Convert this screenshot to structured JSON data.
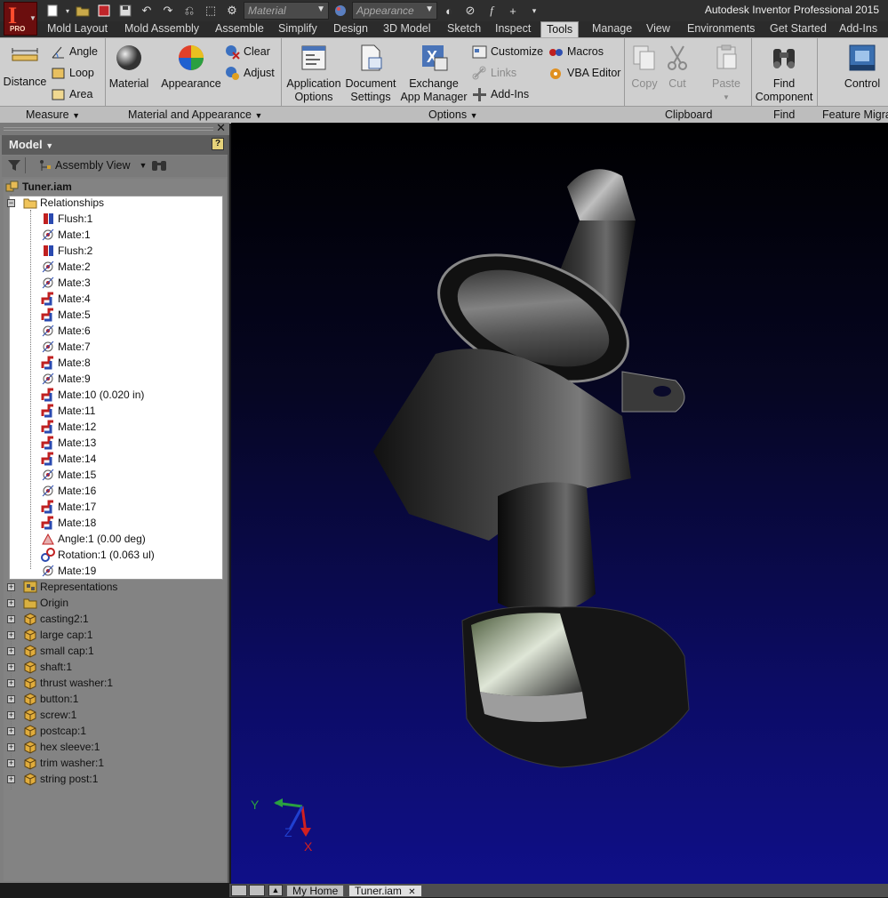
{
  "titlebar": {
    "app_title": "Autodesk Inventor Professional 2015",
    "logo_letter": "I",
    "logo_sub": "PRO",
    "material_select": "Material",
    "appearance_select": "Appearance"
  },
  "ribbon_tabs": [
    {
      "label": "Mold Layout"
    },
    {
      "label": "Mold Assembly"
    },
    {
      "label": "Assemble"
    },
    {
      "label": "Simplify"
    },
    {
      "label": "Design"
    },
    {
      "label": "3D Model"
    },
    {
      "label": "Sketch"
    },
    {
      "label": "Inspect"
    },
    {
      "label": "Tools"
    },
    {
      "label": "Manage"
    },
    {
      "label": "View"
    },
    {
      "label": "Environments"
    },
    {
      "label": "Get Started"
    },
    {
      "label": "Add-Ins"
    }
  ],
  "active_tab": "Tools",
  "ribbon": {
    "distance": "Distance",
    "angle": "Angle",
    "loop": "Loop",
    "area": "Area",
    "material": "Material",
    "appearance": "Appearance",
    "clear": "Clear",
    "adjust": "Adjust",
    "app_options_1": "Application",
    "app_options_2": "Options",
    "doc_settings_1": "Document",
    "doc_settings_2": "Settings",
    "exchange_1": "Exchange",
    "exchange_2": "App Manager",
    "customize": "Customize",
    "links": "Links",
    "addins": "Add-Ins",
    "macros": "Macros",
    "vba_editor": "VBA Editor",
    "copy": "Copy",
    "cut": "Cut",
    "paste": "Paste",
    "find_1": "Find",
    "find_2": "Component",
    "control": "Control",
    "panels": {
      "measure": "Measure",
      "material_appearance": "Material and Appearance",
      "options": "Options",
      "clipboard": "Clipboard",
      "find": "Find",
      "feature_migration": "Feature Migrat"
    }
  },
  "browser": {
    "title": "Model",
    "help": "?",
    "view_mode": "Assembly View",
    "root": "Tuner.iam",
    "relationships_label": "Relationships",
    "relationships": [
      {
        "label": "Flush:1",
        "icon": "flush-constraint-icon"
      },
      {
        "label": "Mate:1",
        "icon": "mate-axis-constraint-icon"
      },
      {
        "label": "Flush:2",
        "icon": "flush-constraint-icon"
      },
      {
        "label": "Mate:2",
        "icon": "mate-axis-constraint-icon"
      },
      {
        "label": "Mate:3",
        "icon": "mate-axis-constraint-icon"
      },
      {
        "label": "Mate:4",
        "icon": "mate-plane-constraint-icon"
      },
      {
        "label": "Mate:5",
        "icon": "mate-plane-constraint-icon"
      },
      {
        "label": "Mate:6",
        "icon": "mate-axis-constraint-icon"
      },
      {
        "label": "Mate:7",
        "icon": "mate-axis-constraint-icon"
      },
      {
        "label": "Mate:8",
        "icon": "mate-plane-constraint-icon"
      },
      {
        "label": "Mate:9",
        "icon": "mate-axis-constraint-icon"
      },
      {
        "label": "Mate:10 (0.020 in)",
        "icon": "mate-plane-constraint-icon"
      },
      {
        "label": "Mate:11",
        "icon": "mate-plane-constraint-icon"
      },
      {
        "label": "Mate:12",
        "icon": "mate-plane-constraint-icon"
      },
      {
        "label": "Mate:13",
        "icon": "mate-plane-constraint-icon"
      },
      {
        "label": "Mate:14",
        "icon": "mate-plane-constraint-icon"
      },
      {
        "label": "Mate:15",
        "icon": "mate-axis-constraint-icon"
      },
      {
        "label": "Mate:16",
        "icon": "mate-axis-constraint-icon"
      },
      {
        "label": "Mate:17",
        "icon": "mate-plane-constraint-icon"
      },
      {
        "label": "Mate:18",
        "icon": "mate-plane-constraint-icon"
      },
      {
        "label": "Angle:1 (0.00 deg)",
        "icon": "angle-constraint-icon"
      },
      {
        "label": "Rotation:1 (0.063 ul)",
        "icon": "rotation-constraint-icon"
      },
      {
        "label": "Mate:19",
        "icon": "mate-axis-constraint-icon"
      }
    ],
    "folders": [
      {
        "label": "Representations",
        "icon": "representations-icon"
      },
      {
        "label": "Origin",
        "icon": "folder-icon"
      }
    ],
    "components": [
      {
        "label": "casting2:1",
        "icon": "part-icon"
      },
      {
        "label": "large cap:1",
        "icon": "part-icon"
      },
      {
        "label": "small cap:1",
        "icon": "part-icon"
      },
      {
        "label": "shaft:1",
        "icon": "part-icon"
      },
      {
        "label": "thrust washer:1",
        "icon": "part-icon"
      },
      {
        "label": "button:1",
        "icon": "part-icon"
      },
      {
        "label": "screw:1",
        "icon": "part-icon"
      },
      {
        "label": "postcap:1",
        "icon": "part-icon"
      },
      {
        "label": "hex sleeve:1",
        "icon": "part-icon"
      },
      {
        "label": "trim washer:1",
        "icon": "part-icon"
      },
      {
        "label": "string post:1",
        "icon": "part-icon"
      }
    ]
  },
  "viewport": {
    "triad_y": "Y",
    "triad_z": "Z",
    "triad_x": "X"
  },
  "doc_tabs": [
    {
      "label": "My Home"
    },
    {
      "label": "Tuner.iam"
    }
  ]
}
